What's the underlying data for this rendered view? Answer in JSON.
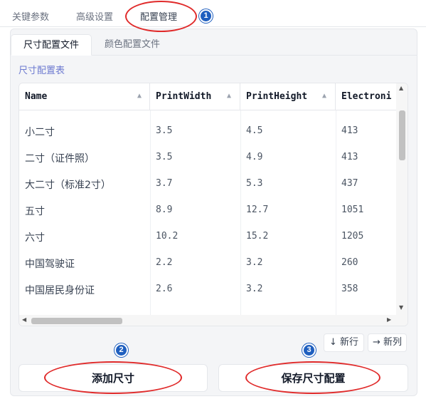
{
  "top_tabs": [
    {
      "label": "关键参数"
    },
    {
      "label": "高级设置"
    },
    {
      "label": "配置管理"
    }
  ],
  "sub_tabs": [
    {
      "label": "尺寸配置文件"
    },
    {
      "label": "颜色配置文件"
    }
  ],
  "table": {
    "title": "尺寸配置表",
    "columns": [
      {
        "label": "Name"
      },
      {
        "label": "PrintWidth"
      },
      {
        "label": "PrintHeight"
      },
      {
        "label": "Electroni"
      }
    ],
    "rows": [
      [
        "小二寸",
        "3.5",
        "4.5",
        "413"
      ],
      [
        "二寸（证件照）",
        "3.5",
        "4.9",
        "413"
      ],
      [
        "大二寸（标准2寸）",
        "3.7",
        "5.3",
        "437"
      ],
      [
        "五寸",
        "8.9",
        "12.7",
        "1051"
      ],
      [
        "六寸",
        "10.2",
        "15.2",
        "1205"
      ],
      [
        "中国驾驶证",
        "2.2",
        "3.2",
        "260"
      ],
      [
        "中国居民身份证",
        "2.6",
        "3.2",
        "358"
      ]
    ]
  },
  "table_actions": {
    "new_row": "↓ 新行",
    "new_col": "→ 新列"
  },
  "buttons": {
    "add_size": "添加尺寸",
    "save_size": "保存尺寸配置"
  },
  "annotations": {
    "marker_1": "1",
    "marker_2": "2",
    "marker_3": "3",
    "color": "#e02a2a",
    "marker_color": "#1f5fbf"
  },
  "icons": {
    "sort": "sort-arrow-up-icon",
    "scroll_up": "triangle-up-icon",
    "scroll_down": "triangle-down-icon",
    "scroll_left": "triangle-left-icon",
    "scroll_right": "triangle-right-icon"
  }
}
